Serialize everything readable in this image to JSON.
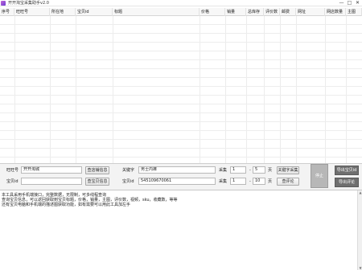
{
  "window": {
    "title": "开开淘宝采集助手v2.0",
    "min_glyph": "—",
    "max_glyph": "□",
    "close_glyph": "✕"
  },
  "table": {
    "columns": [
      "序号",
      "旺旺号",
      "所在地",
      "宝贝id",
      "标题",
      "价格",
      "销量",
      "总库存",
      "评价数",
      "邮费",
      "网址",
      "网店数量",
      "主图"
    ],
    "rows": []
  },
  "shop_section": {
    "wangwang_label": "旺旺号",
    "wangwang_value": "开开淘城",
    "query_shop_button": "查店铺信息",
    "item_id_label": "宝贝id",
    "item_id_value": "",
    "query_item_button": "查宝贝信息"
  },
  "keyword_section": {
    "keyword_label": "关键字",
    "keyword_value": "男士内裤",
    "collect_label": "采集",
    "page_from": "1",
    "separator": "-",
    "page_to": "5",
    "page_unit": "页",
    "keyword_collect_button": "关键字采集"
  },
  "item_section": {
    "item_id_label": "宝贝id",
    "item_id_value": "545109670061",
    "collect_label": "采集",
    "page_from": "1",
    "separator": "-",
    "page_to": "10",
    "page_unit": "页",
    "query_reviews_button": "查评论"
  },
  "side_buttons": {
    "stop_label": "停止",
    "export_items_label": "导出宝贝id",
    "export_reviews_label": "导出评论"
  },
  "log": {
    "lines": [
      "本工具采用手机端接口，完整数据，无限制，可多线程查询",
      "查询宝贝信息，可以返回获取到宝贝标题，价格，销量，主图，评价数，视频，sku，收藏数，等等",
      "还有宝贝电脑和手机端的描述图获取功能，如有需要可以用此工具加左手"
    ]
  }
}
